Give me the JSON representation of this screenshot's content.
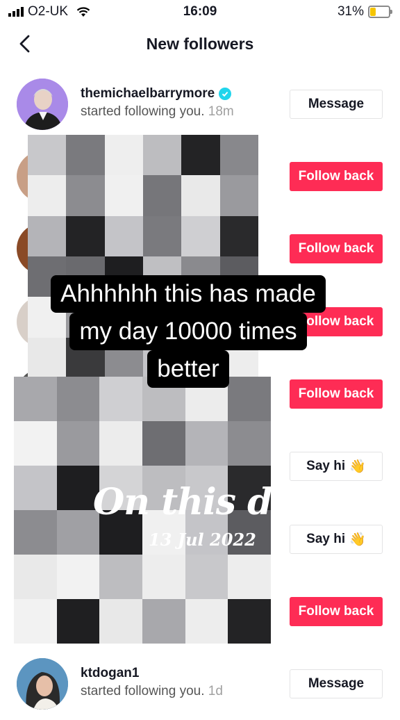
{
  "status_bar": {
    "carrier": "O2-UK",
    "time": "16:09",
    "battery_percent": "31%",
    "battery_level": 0.31
  },
  "header": {
    "title": "New followers"
  },
  "rows": [
    {
      "username": "themichaelbarrymore",
      "verified": true,
      "action": "started following you.",
      "time": "18m",
      "button": "Message",
      "button_style": "outline"
    },
    {
      "username": "",
      "action": "",
      "time": "",
      "button": "Follow back",
      "button_style": "red"
    },
    {
      "username": "",
      "action": "",
      "time": "",
      "button": "Follow back",
      "button_style": "red"
    },
    {
      "username": "",
      "action": "",
      "time": "",
      "button": "Follow back",
      "button_style": "red"
    },
    {
      "username": "",
      "action": "",
      "time": "",
      "button": "Follow back",
      "button_style": "red"
    },
    {
      "username": "",
      "action": "",
      "time": "",
      "button": "Say hi",
      "button_icon": "👋",
      "button_style": "outline"
    },
    {
      "username": "",
      "action": "",
      "time": "",
      "button": "Say hi",
      "button_icon": "👋",
      "button_style": "outline"
    },
    {
      "username": "",
      "action": "",
      "time": "",
      "button": "Follow back",
      "button_style": "red"
    },
    {
      "username": "ktdogan1",
      "action": "started following you.",
      "time": "1d",
      "button": "Message",
      "button_style": "outline"
    }
  ],
  "overlay": {
    "caption_lines": [
      "Ahhhhhh this has made",
      "my day 10000 times",
      "better"
    ],
    "on_this_day": "On this day",
    "date": "13 Jul 2022"
  },
  "colors": {
    "accent": "#fe2c55",
    "verified": "#20d5ec",
    "text": "#161823",
    "secondary": "#a0a0a0"
  }
}
